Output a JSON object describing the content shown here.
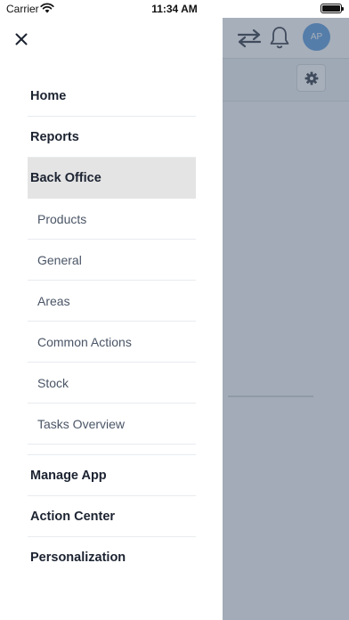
{
  "status_bar": {
    "carrier": "Carrier",
    "time": "11:34 AM"
  },
  "header": {
    "avatar_initials": "AP",
    "icons": [
      "swap-arrows-icon",
      "bell-icon"
    ]
  },
  "toolbar": {
    "icons": [
      "gear-icon"
    ]
  },
  "drawer": {
    "icons": [
      "close-icon"
    ],
    "items_top": [
      {
        "label": "Home"
      },
      {
        "label": "Reports"
      },
      {
        "label": "Back Office",
        "active": true
      }
    ],
    "sub_items": [
      {
        "label": "Products"
      },
      {
        "label": "General"
      },
      {
        "label": "Areas"
      },
      {
        "label": "Common Actions"
      },
      {
        "label": "Stock"
      },
      {
        "label": "Tasks Overview"
      }
    ],
    "items_bottom": [
      {
        "label": "Manage App"
      },
      {
        "label": "Action Center"
      },
      {
        "label": "Personalization"
      }
    ]
  },
  "colors": {
    "accent": "#4a90d9",
    "active_bg": "#e4e4e4",
    "text_primary": "#1c2331",
    "text_secondary": "#4a5566"
  }
}
